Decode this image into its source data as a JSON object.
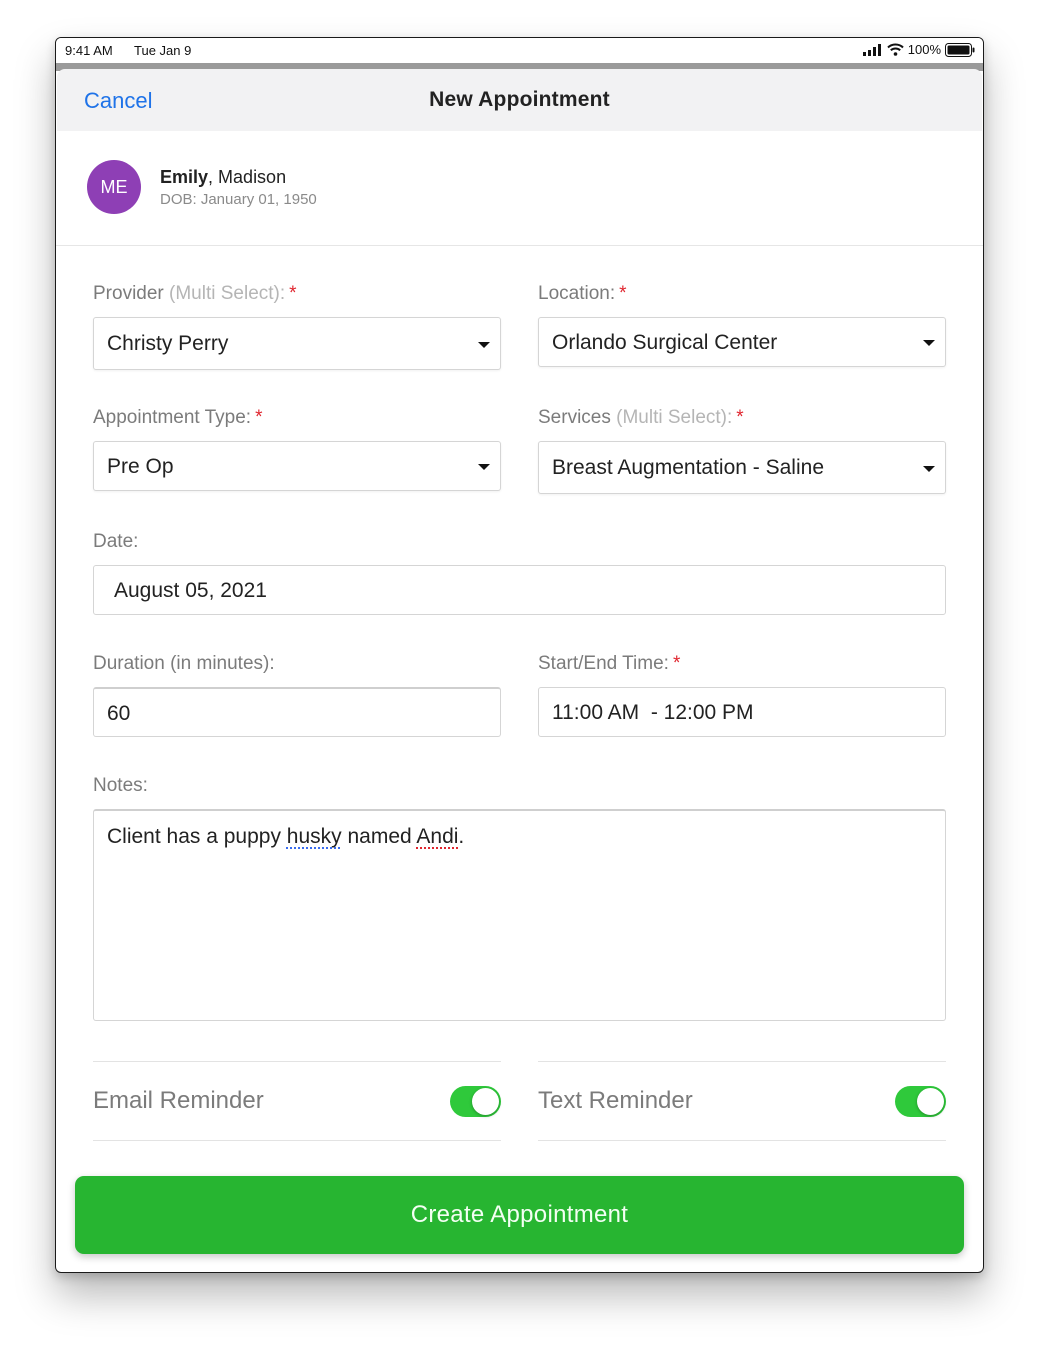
{
  "status_bar": {
    "time": "9:41 AM",
    "date": "Tue Jan 9",
    "battery": "100%"
  },
  "nav": {
    "cancel_label": "Cancel",
    "title": "New Appointment"
  },
  "patient": {
    "initials": "ME",
    "first_name": "Emily",
    "last_name": "Madison",
    "dob": "DOB: January 01, 1950",
    "avatar_color": "#8e3fb5"
  },
  "form": {
    "provider": {
      "label": "Provider",
      "hint": "(Multi Select):",
      "required": "*",
      "value": "Christy Perry"
    },
    "location": {
      "label": "Location:",
      "required": "*",
      "value": "Orlando Surgical Center"
    },
    "appointment_type": {
      "label": "Appointment Type:",
      "required": "*",
      "value": "Pre Op"
    },
    "services": {
      "label": "Services",
      "hint": "(Multi Select):",
      "required": "*",
      "value": "Breast Augmentation - Saline"
    },
    "date": {
      "label": "Date:",
      "value": "August 05, 2021"
    },
    "duration": {
      "label": "Duration (in minutes):",
      "value": "60"
    },
    "start_end": {
      "label": "Start/End Time:",
      "required": "*",
      "value": "11:00 AM  - 12:00 PM"
    },
    "notes": {
      "label": "Notes:",
      "text_parts": [
        "Client has a puppy ",
        "husky",
        " named ",
        "Andi",
        "."
      ]
    },
    "email_reminder": {
      "label": "Email Reminder",
      "on": true
    },
    "text_reminder": {
      "label": "Text Reminder",
      "on": true
    }
  },
  "create_button_label": "Create Appointment",
  "colors": {
    "accent_link": "#1f73e8",
    "create_button": "#27b531",
    "toggle_on": "#2fc93b",
    "required": "#e0262f"
  }
}
